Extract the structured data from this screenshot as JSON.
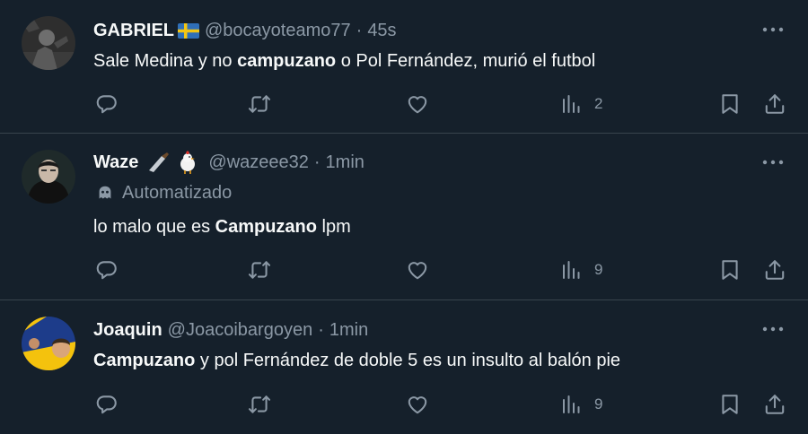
{
  "colors": {
    "background": "#15202b",
    "divider": "#38444d",
    "muted": "#8b98a5",
    "text": "#f7f9f9"
  },
  "tweets": [
    {
      "name": "GABRIEL",
      "emoji": "🇸🇪",
      "handle": "@bocayoteamo77",
      "dot": "·",
      "time": "45s",
      "text": [
        "Sale Medina y no ",
        "campuzano",
        " o Pol Fernández, murió el futbol"
      ],
      "views": "2",
      "icons": [
        "reply-icon",
        "retweet-icon",
        "like-icon",
        "views-icon",
        "bookmark-icon",
        "share-icon",
        "more-icon"
      ]
    },
    {
      "name": "Waze",
      "emoji": "🔪 🐔",
      "handle": "@wazeee32",
      "dot": "·",
      "time": "1min",
      "automated_label": "Automatizado",
      "text": [
        "lo malo que es ",
        "Campuzano",
        " lpm"
      ],
      "views": "9"
    },
    {
      "name": "Joaquin",
      "handle": "@Joacoibargoyen",
      "dot": "·",
      "time": "1min",
      "text": [
        "Campuzano",
        " y pol Fernández de doble 5 es un insulto al balón pie"
      ],
      "views": "9"
    }
  ]
}
